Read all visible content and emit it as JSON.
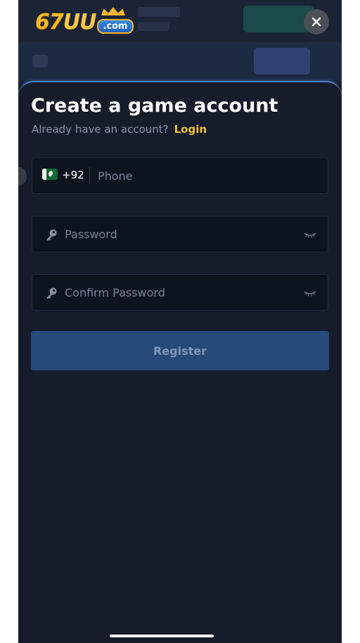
{
  "brand": {
    "logo_digits": "67",
    "logo_letters": "UU",
    "logo_suffix": ".com"
  },
  "modal": {
    "close_icon": "close-icon",
    "title": "Create a game account",
    "subtitle_prefix": "Already have an account?",
    "login_label": "Login"
  },
  "form": {
    "phone": {
      "country_flag": "pakistan-flag-icon",
      "country_code": "+92",
      "placeholder": "Phone",
      "value": ""
    },
    "password": {
      "icon": "key-icon",
      "placeholder": "Password",
      "value": "",
      "toggle_icon": "eye-closed-icon"
    },
    "confirm_password": {
      "icon": "key-icon",
      "placeholder": "Confirm Password",
      "value": "",
      "toggle_icon": "eye-closed-icon"
    },
    "register_label": "Register"
  },
  "colors": {
    "accent_link": "#f3c13a",
    "sheet_background": "#161c2a",
    "register_button": "#254a7a",
    "sheet_border": "#4f86d2"
  }
}
